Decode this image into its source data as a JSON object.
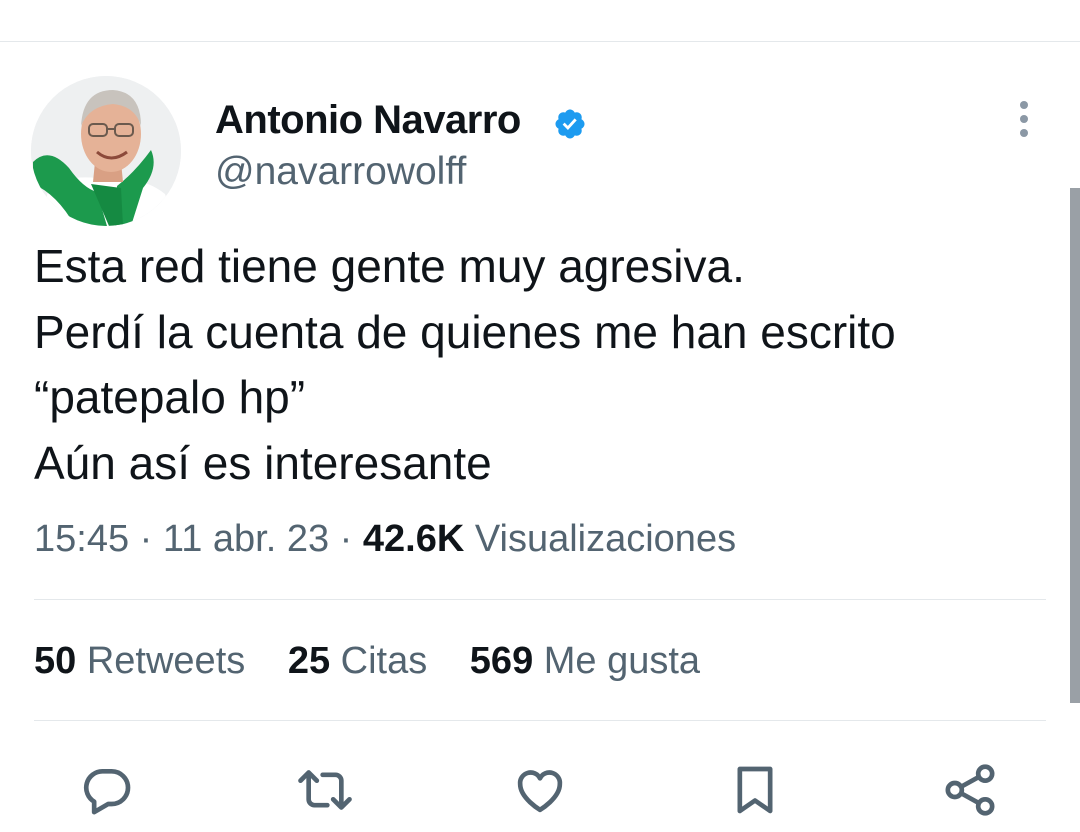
{
  "tweet": {
    "author": {
      "name": "Antonio Navarro",
      "handle": "@navarrowolff",
      "verified": true,
      "avatar_icon": "profile-photo"
    },
    "text": "Esta red tiene gente muy agresiva.\nPerdí la cuenta de quienes me han escrito\n“patepalo hp”\nAún así es interesante",
    "time": "15:45",
    "separator": "·",
    "date": "11 abr. 23",
    "views_count": "42.6K",
    "views_label": "Visualizaciones",
    "stats": [
      {
        "count": "50",
        "label": "Retweets"
      },
      {
        "count": "25",
        "label": "Citas"
      },
      {
        "count": "569",
        "label": "Me gusta"
      }
    ],
    "actions": [
      "reply-icon",
      "retweet-icon",
      "like-icon",
      "bookmark-icon",
      "share-icon"
    ]
  },
  "colors": {
    "text_primary": "#0f1419",
    "text_secondary": "#536471",
    "verified_blue": "#1d9bf0",
    "divider": "#e4e8eb"
  }
}
